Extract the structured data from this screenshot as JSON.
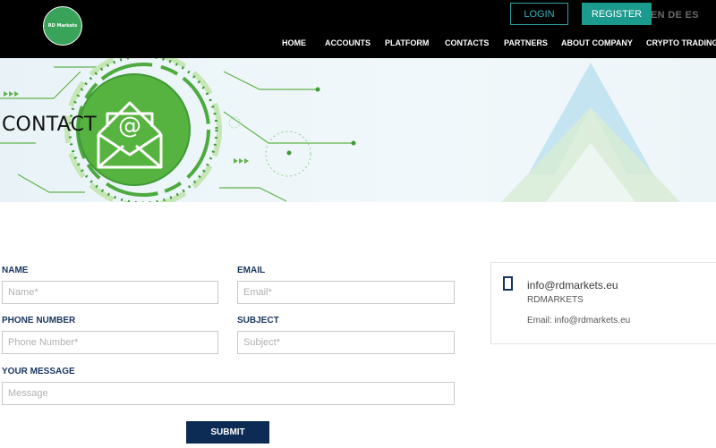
{
  "brand": {
    "logo_text": "RD Markets"
  },
  "header": {
    "login": "LOGIN",
    "register": "REGISTER",
    "languages": "EN DE ES"
  },
  "nav": {
    "items": [
      "HOME",
      "ACCOUNTS",
      "PLATFORM",
      "CONTACTS",
      "PARTNERS",
      "ABOUT COMPANY",
      "CRYPTO TRADING"
    ]
  },
  "hero": {
    "title": "CONTACT"
  },
  "form": {
    "name_label": "NAME",
    "name_placeholder": "Name*",
    "email_label": "EMAIL",
    "email_placeholder": "Email*",
    "phone_label": "PHONE NUMBER",
    "phone_placeholder": "Phone Number*",
    "subject_label": "SUBJECT",
    "subject_placeholder": "Subject*",
    "message_label": "YOUR MESSAGE",
    "message_placeholder": "Message",
    "submit": "SUBMIT"
  },
  "contact_card": {
    "icon": "phone-icon",
    "email": "info@rdmarkets.eu",
    "company": "RDMARKETS",
    "email_line": "Email: info@rdmarkets.eu"
  },
  "colors": {
    "header_bg": "#000000",
    "accent_teal": "#1b9a8e",
    "navy": "#0d2c55",
    "green": "#3aa35a"
  }
}
